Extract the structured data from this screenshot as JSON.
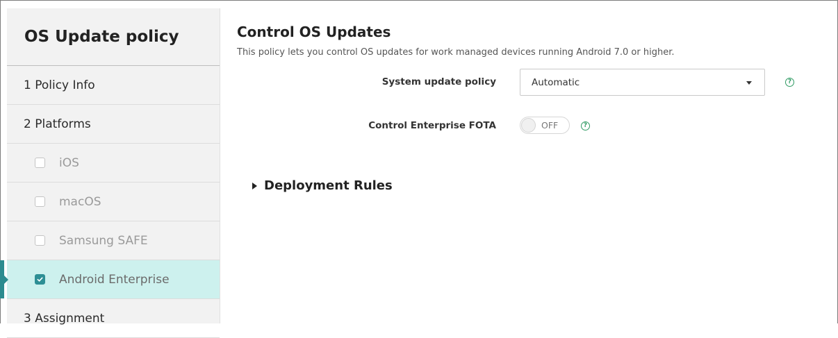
{
  "sidebar": {
    "title": "OS Update policy",
    "steps": [
      {
        "label": "1  Policy Info"
      },
      {
        "label": "2  Platforms"
      }
    ],
    "platforms": [
      {
        "label": "iOS",
        "checked": false
      },
      {
        "label": "macOS",
        "checked": false
      },
      {
        "label": "Samsung SAFE",
        "checked": false
      },
      {
        "label": "Android Enterprise",
        "checked": true
      }
    ],
    "assignment": {
      "label": "3  Assignment"
    }
  },
  "main": {
    "title": "Control OS Updates",
    "description": "This policy lets you control OS updates for work managed devices running Android 7.0 or higher.",
    "system_update_policy": {
      "label": "System update policy",
      "value": "Automatic"
    },
    "control_enterprise_fota": {
      "label": "Control Enterprise FOTA",
      "state": "OFF"
    },
    "deployment_rules": {
      "label": "Deployment Rules"
    }
  },
  "colors": {
    "accent": "#2b8b8f",
    "active_bg": "#cdf1ee",
    "help_icon": "#2f9a63"
  }
}
